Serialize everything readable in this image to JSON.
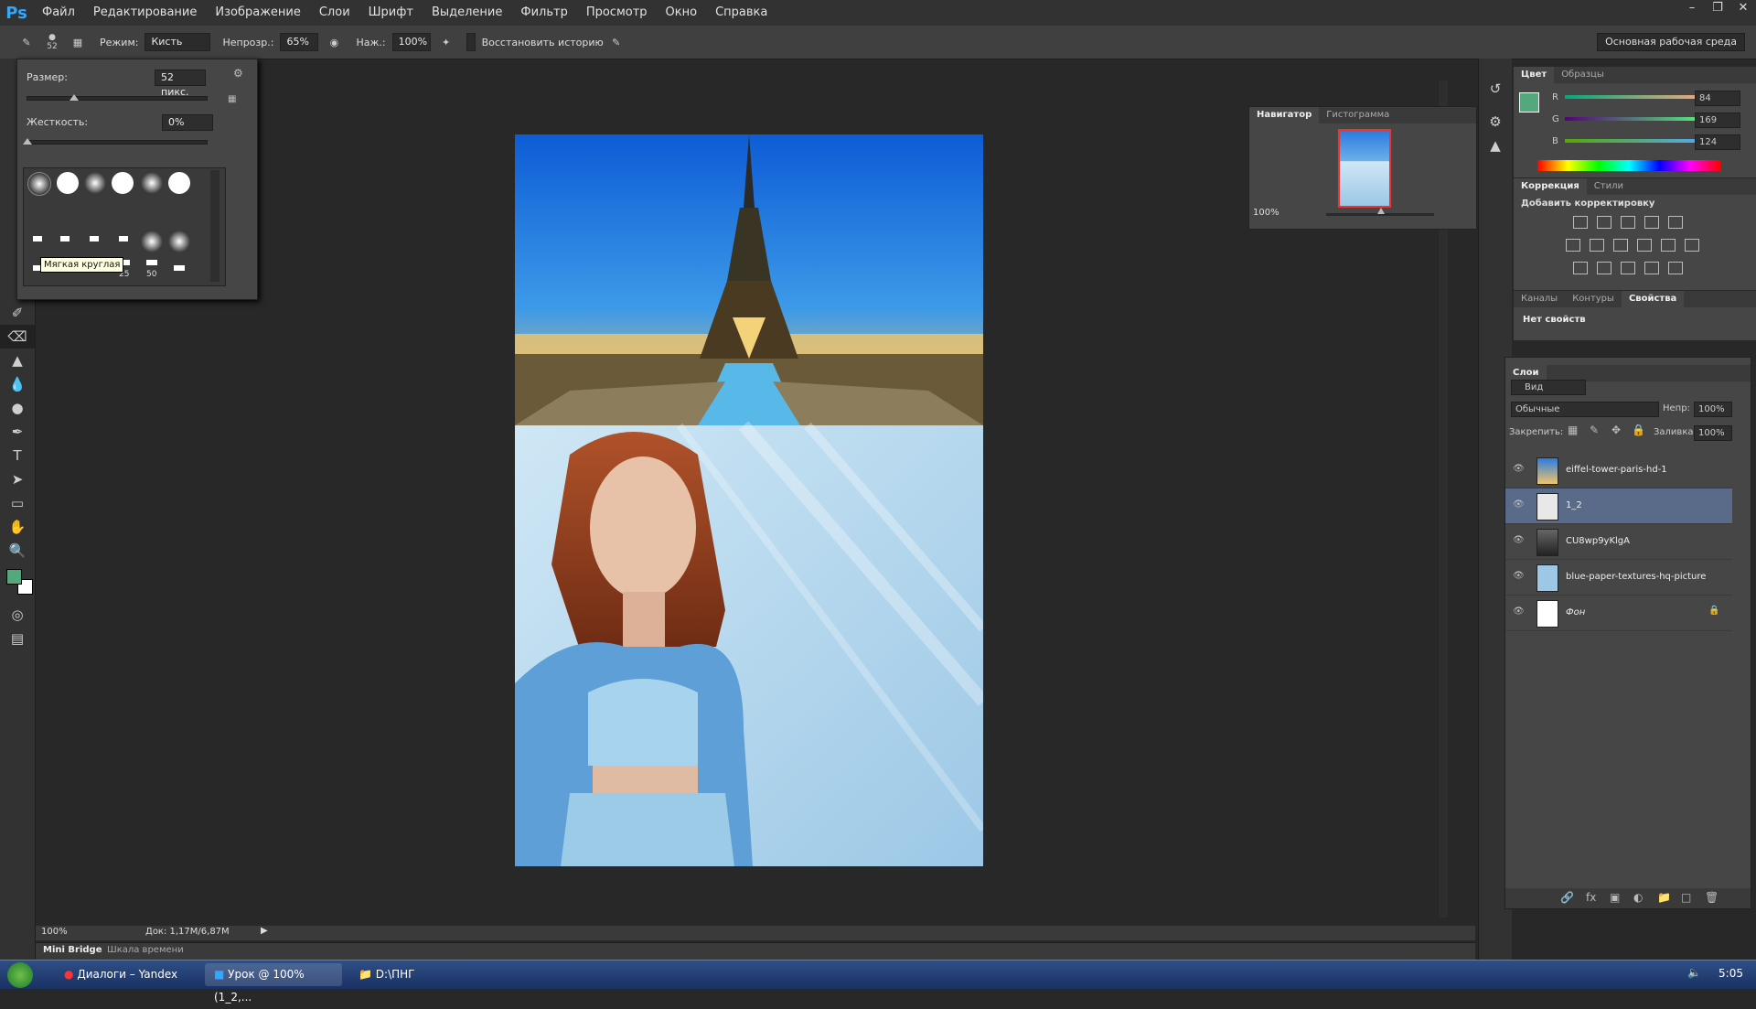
{
  "app": {
    "logo": "Ps"
  },
  "menu": [
    "Файл",
    "Редактирование",
    "Изображение",
    "Слои",
    "Шрифт",
    "Выделение",
    "Фильтр",
    "Просмотр",
    "Окно",
    "Справка"
  ],
  "options_bar": {
    "brush_size": "52",
    "mode_label": "Режим:",
    "mode_value": "Кисть",
    "opacity_label": "Непрозр.:",
    "opacity_value": "65%",
    "flow_label": "Наж.:",
    "flow_value": "100%",
    "restore_history": "Восстановить историю",
    "workspace": "Основная рабочая среда"
  },
  "brush_panel": {
    "size_label": "Размер:",
    "size_value": "52 пикс.",
    "hardness_label": "Жесткость:",
    "hardness_value": "0%",
    "tooltip": "Мягкая круглая",
    "preset_num_1": "25",
    "preset_num_2": "50"
  },
  "navigator": {
    "tab_active": "Навигатор",
    "tab_other": "Гистограмма",
    "zoom": "100%"
  },
  "color_panel": {
    "tab_active": "Цвет",
    "tab_other": "Образцы",
    "r_label": "R",
    "r": "84",
    "g_label": "G",
    "g": "169",
    "b_label": "B",
    "b": "124",
    "foreground": "#54a97c"
  },
  "correction_panel": {
    "tab_active": "Коррекция",
    "tab_other": "Стили",
    "heading": "Добавить корректировку"
  },
  "properties_panel": {
    "tab1": "Каналы",
    "tab2": "Контуры",
    "tab_active": "Свойства",
    "empty": "Нет свойств"
  },
  "layers_panel": {
    "title": "Слои",
    "filter": "Вид",
    "blend_mode": "Обычные",
    "opacity_label": "Непр:",
    "opacity": "100%",
    "lock_label": "Закрепить:",
    "fill_label": "Заливка:",
    "fill": "100%",
    "layers": [
      {
        "name": "eiffel-tower-paris-hd-1"
      },
      {
        "name": "1_2"
      },
      {
        "name": "CU8wp9yKlgA"
      },
      {
        "name": "blue-paper-textures-hq-picture"
      },
      {
        "name": "Фон"
      }
    ]
  },
  "status_bar": {
    "zoom": "100%",
    "doc": "Док: 1,17M/6,87M"
  },
  "bottom_tabs": {
    "tab_active": "Mini Bridge",
    "tab_other": "Шкала времени"
  },
  "taskbar": {
    "items": [
      "Диалоги – Yandex",
      "Урок @ 100% (1_2,...",
      "D:\\ПНГ"
    ],
    "clock": "5:05"
  }
}
